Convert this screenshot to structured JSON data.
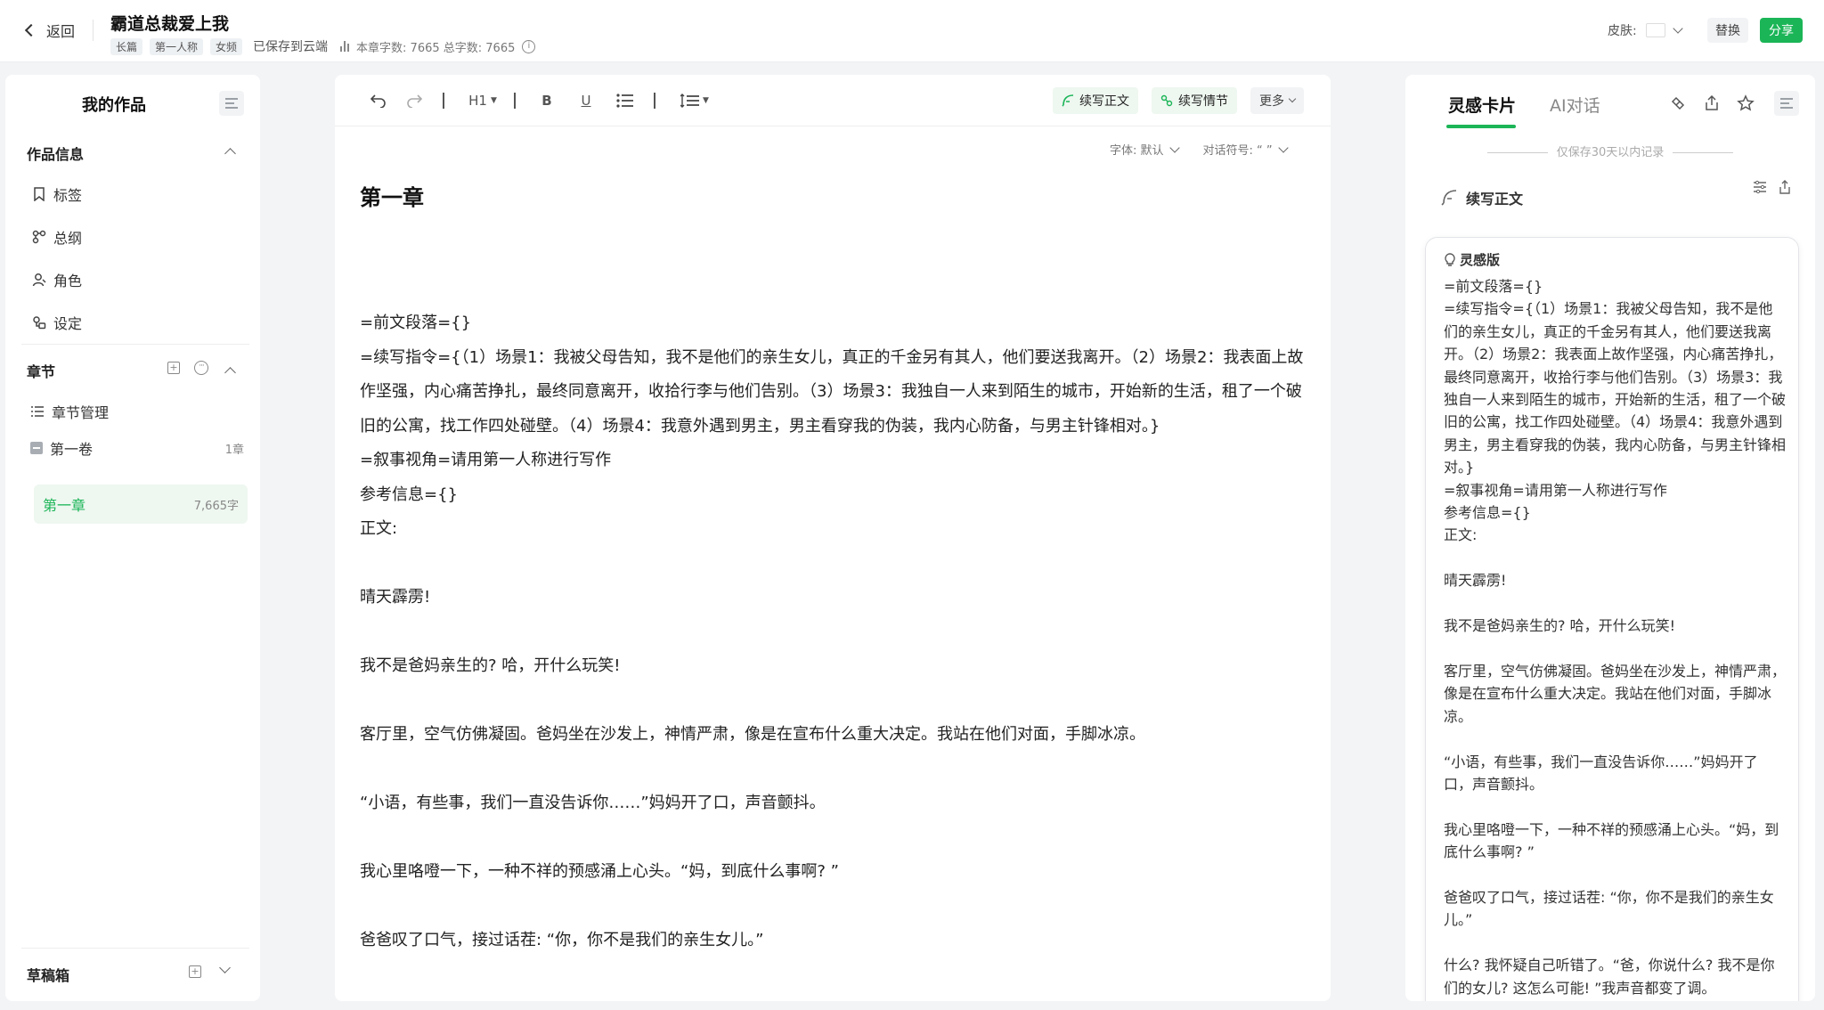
{
  "header": {
    "back_label": "返回",
    "work_title": "霸道总裁爱上我",
    "tags": [
      "长篇",
      "第一人称",
      "女频"
    ],
    "save_status": "已保存到云端",
    "word_stats": "本章字数: 7665  总字数: 7665",
    "skin_label": "皮肤:",
    "replace_label": "替换",
    "share_label": "分享",
    "accent_color": "#1bb557"
  },
  "sidebar": {
    "title": "我的作品",
    "work_info": {
      "heading": "作品信息",
      "items": [
        {
          "label": "标签",
          "icon": "bookmark-icon"
        },
        {
          "label": "总纲",
          "icon": "outline-icon"
        },
        {
          "label": "角色",
          "icon": "character-icon"
        },
        {
          "label": "设定",
          "icon": "setting-icon"
        }
      ]
    },
    "chapters": {
      "heading": "章节",
      "manage_label": "章节管理",
      "volume": {
        "name": "第一卷",
        "count": "1章"
      },
      "chapter": {
        "name": "第一章",
        "word_count": "7,665字"
      }
    },
    "drafts_label": "草稿箱"
  },
  "editor": {
    "toolbar": {
      "heading_label": "H1",
      "bold_label": "B",
      "underline_label": "U",
      "continue_text_label": "续写正文",
      "continue_plot_label": "续写情节",
      "more_label": "更多"
    },
    "font_label": "字体: 默认",
    "quote_label": "对话符号: “ ”",
    "chapter_title": "第一章",
    "paragraphs": [
      "=前文段落={}",
      "=续写指令={（1）场景1：我被父母告知，我不是他们的亲生女儿，真正的千金另有其人，他们要送我离开。（2）场景2：我表面上故作坚强，内心痛苦挣扎，最终同意离开，收拾行李与他们告别。（3）场景3：我独自一人来到陌生的城市，开始新的生活，租了一个破旧的公寓，找工作四处碰壁。（4）场景4：我意外遇到男主，男主看穿我的伪装，我内心防备，与男主针锋相对。}",
      "=叙事视角=请用第一人称进行写作",
      "参考信息={}",
      "正文:",
      "",
      "晴天霹雳!",
      "",
      "我不是爸妈亲生的? 哈，开什么玩笑!",
      "",
      "客厅里，空气仿佛凝固。爸妈坐在沙发上，神情严肃，像是在宣布什么重大决定。我站在他们对面，手脚冰凉。",
      "",
      "“小语，有些事，我们一直没告诉你……”妈妈开了口，声音颤抖。",
      "",
      "我心里咯噔一下，一种不祥的预感涌上心头。“妈，到底什么事啊? ”",
      "",
      "爸爸叹了口气，接过话茬: “你，你不是我们的亲生女儿。”"
    ]
  },
  "right_panel": {
    "tab_active": "灵感卡片",
    "tab_other": "AI对话",
    "keep_note": "仅保存30天以内记录",
    "continue_heading": "续写正文",
    "card_heading": "灵感版",
    "card_paragraphs": [
      "=前文段落={}",
      "=续写指令={（1）场景1：我被父母告知，我不是他们的亲生女儿，真正的千金另有其人，他们要送我离开。（2）场景2：我表面上故作坚强，内心痛苦挣扎，最终同意离开，收拾行李与他们告别。（3）场景3：我独自一人来到陌生的城市，开始新的生活，租了一个破旧的公寓，找工作四处碰壁。（4）场景4：我意外遇到男主，男主看穿我的伪装，我内心防备，与男主针锋相对。}",
      "=叙事视角=请用第一人称进行写作",
      "参考信息={}",
      "正文:",
      "",
      "晴天霹雳!",
      "",
      "我不是爸妈亲生的? 哈，开什么玩笑!",
      "",
      "客厅里，空气仿佛凝固。爸妈坐在沙发上，神情严肃，像是在宣布什么重大决定。我站在他们对面，手脚冰凉。",
      "",
      "“小语，有些事，我们一直没告诉你……”妈妈开了口，声音颤抖。",
      "",
      "我心里咯噔一下，一种不祥的预感涌上心头。“妈，到底什么事啊? ”",
      "",
      "爸爸叹了口气，接过话茬: “你，你不是我们的亲生女儿。”",
      "",
      "什么? 我怀疑自己听错了。“爸，你说什么? 我不是你们的女儿? 这怎么可能! ”我声音都变了调。"
    ]
  }
}
